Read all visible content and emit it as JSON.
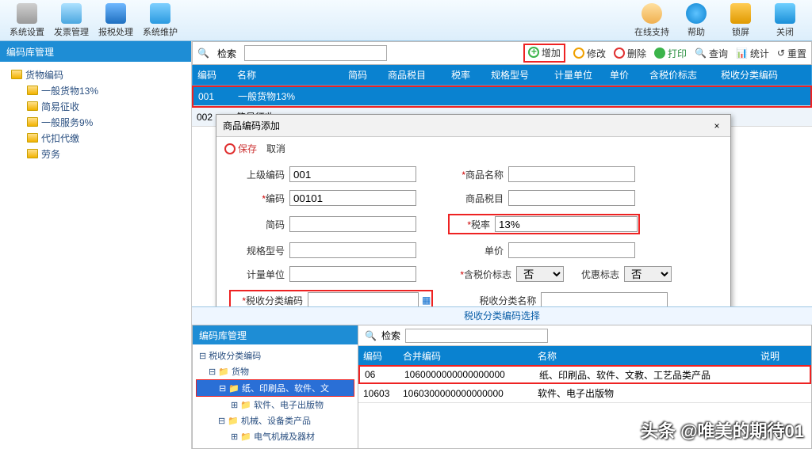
{
  "toolbar": {
    "items": [
      "系统设置",
      "发票管理",
      "报税处理",
      "系统维护"
    ],
    "right": [
      "在线支持",
      "帮助",
      "锁屏",
      "关闭"
    ]
  },
  "tree": {
    "title": "编码库管理",
    "root": "货物编码",
    "children": [
      "一般货物13%",
      "简易征收",
      "一般服务9%",
      "代扣代缴",
      "劳务"
    ]
  },
  "actionbar": {
    "search": "检索",
    "add": "增加",
    "edit": "修改",
    "del": "删除",
    "print": "打印",
    "query": "查询",
    "stats": "统计",
    "reset": "重置"
  },
  "grid": {
    "headers": [
      "编码",
      "名称",
      "简码",
      "商品税目",
      "税率",
      "规格型号",
      "计量单位",
      "单价",
      "含税价标志",
      "税收分类编码"
    ],
    "rows": [
      {
        "code": "001",
        "name": "一般货物13%"
      },
      {
        "code": "002",
        "name": "简易征收"
      }
    ]
  },
  "dialog": {
    "title": "商品编码添加",
    "save": "保存",
    "cancel": "取消",
    "fields": {
      "parent_code_l": "上级编码",
      "parent_code": "001",
      "code_l": "编码",
      "code": "00101",
      "short_l": "简码",
      "spec_l": "规格型号",
      "unit_l": "计量单位",
      "taxcode_l": "税收分类编码",
      "name_l": "商品名称",
      "item_l": "商品税目",
      "rate_l": "税率",
      "rate": "13%",
      "u_l": "单价",
      "taxflag_l": "含税价标志",
      "taxflag": "否",
      "pref_l": "优惠标志",
      "pref": "否",
      "taxname_l": "税收分类名称"
    }
  },
  "lower": {
    "title": "税收分类编码选择",
    "panel": "编码库管理",
    "tree_root": "税收分类编码",
    "tree": [
      "货物",
      "纸、印刷品、软件、文",
      "软件、电子出版物",
      "机械、设备类产品",
      "电气机械及器材"
    ],
    "search": "检索",
    "headers": [
      "编码",
      "合并编码",
      "名称",
      "说明"
    ],
    "rows": [
      {
        "code": "06",
        "merge": "1060000000000000000",
        "name": "纸、印刷品、软件、文教、工艺品类产品"
      },
      {
        "code": "10603",
        "merge": "1060300000000000000",
        "name": "软件、电子出版物"
      }
    ]
  },
  "watermark": "头条 @唯美的期待01"
}
